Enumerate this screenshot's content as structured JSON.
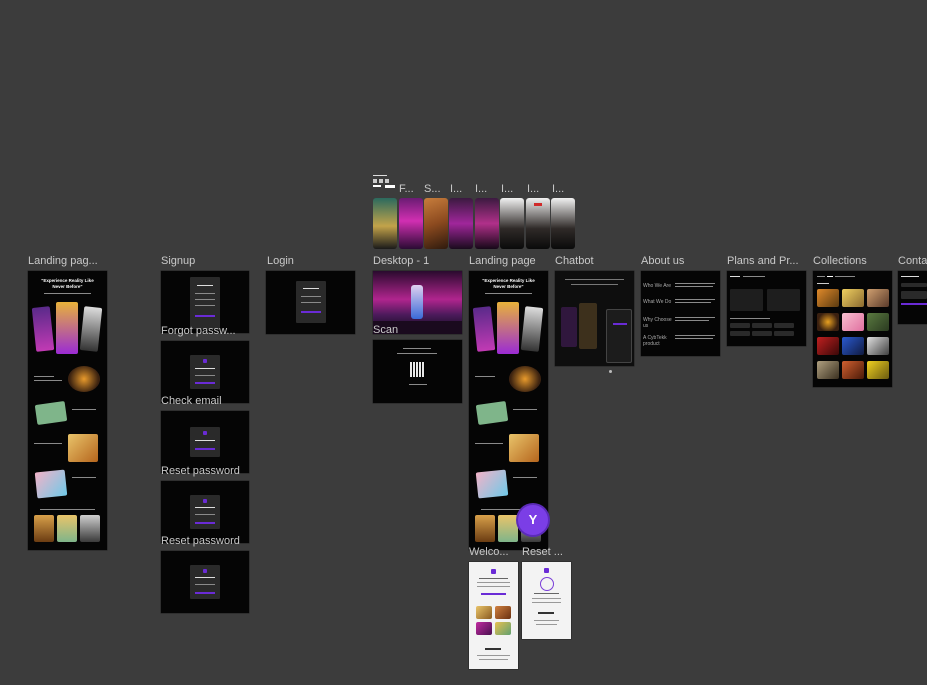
{
  "top_strip": {
    "labels": [
      "F...",
      "S...",
      "I...",
      "I...",
      "I...",
      "I...",
      "I..."
    ]
  },
  "frames": {
    "landing_page_1": "Landing pag...",
    "signup": "Signup",
    "login": "Login",
    "desktop_1": "Desktop - 1",
    "landing_page_2": "Landing page",
    "chatbot": "Chatbot",
    "about_us": "About us",
    "plans": "Plans and Pr...",
    "collections": "Collections",
    "contact": "Conta",
    "forgot_password": "Forgot passw...",
    "check_email": "Check email",
    "reset_password_1": "Reset password",
    "reset_password_2": "Reset password",
    "scan": "Scan",
    "welcome": "Welco...",
    "reset_short": "Reset ..."
  },
  "landing": {
    "headline": "\"Experience Reality Like Never Before\""
  },
  "about": {
    "rows": [
      "Who We Are",
      "What We Do",
      "Why Choose us",
      "A CybTekk product"
    ]
  },
  "avatar": {
    "initial": "Y"
  }
}
